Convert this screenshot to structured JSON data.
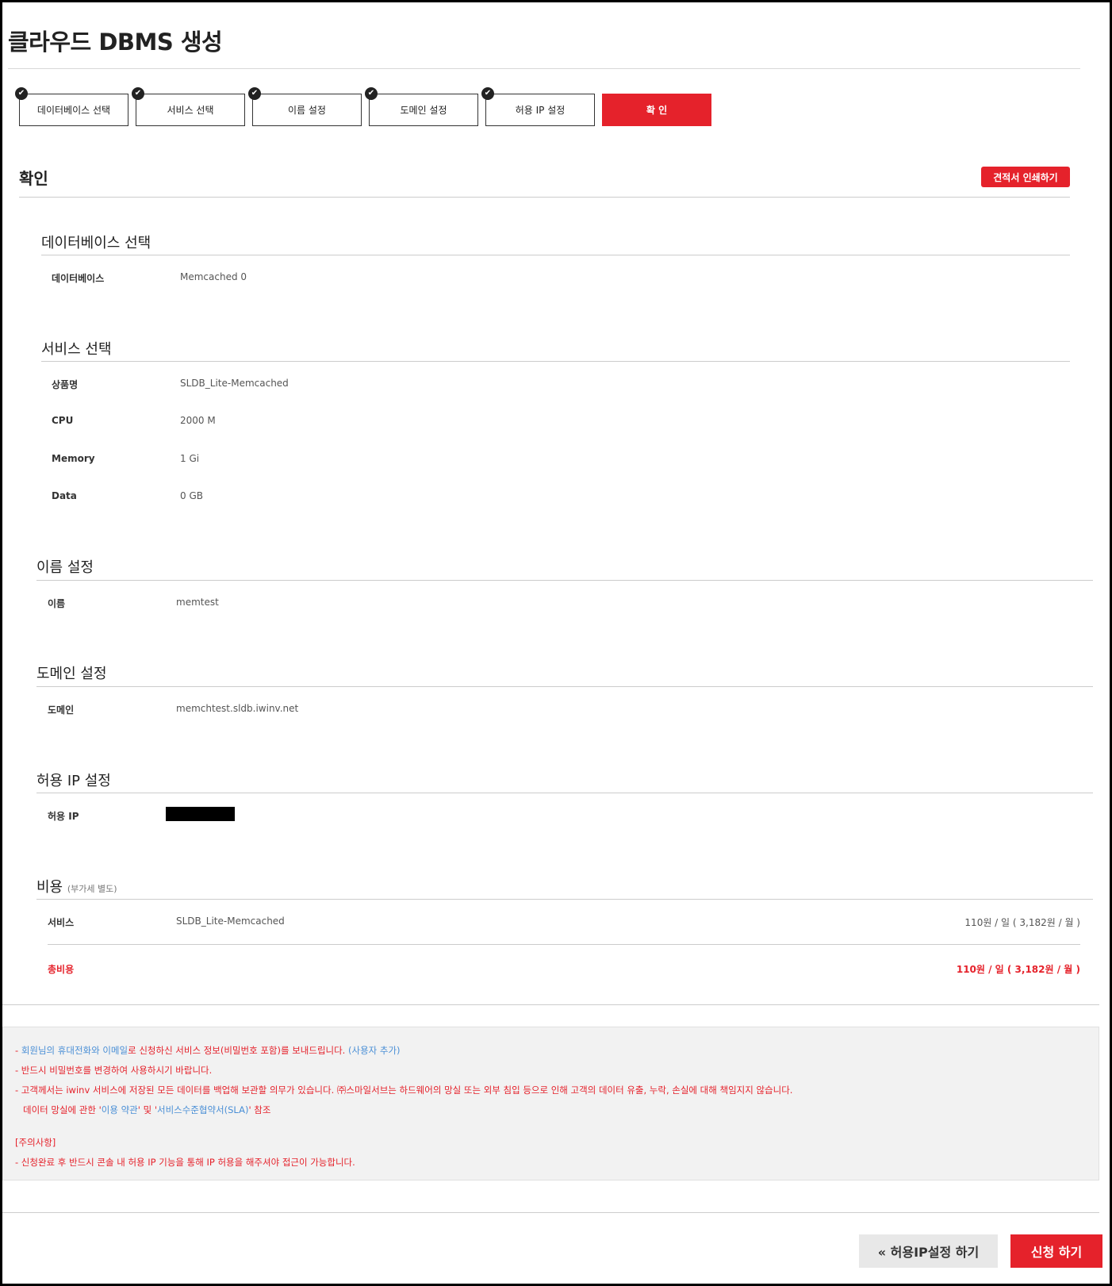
{
  "page": {
    "title": "클라우드 DBMS 생성"
  },
  "steps": [
    {
      "label": "데이터베이스 선택",
      "done": true
    },
    {
      "label": "서비스 선택",
      "done": true
    },
    {
      "label": "이름 설정",
      "done": true
    },
    {
      "label": "도메인 설정",
      "done": true
    },
    {
      "label": "허용 IP 설정",
      "done": true
    },
    {
      "label": "확 인",
      "done": false,
      "active": true
    }
  ],
  "confirm": {
    "title": "확인",
    "print_label": "견적서 인쇄하기"
  },
  "database": {
    "title": "데이터베이스 선택",
    "label": "데이터베이스",
    "value": "Memcached 0"
  },
  "service": {
    "title": "서비스 선택",
    "rows": [
      {
        "label": "상품명",
        "value": "SLDB_Lite-Memcached"
      },
      {
        "label": "CPU",
        "value": "2000 M"
      },
      {
        "label": "Memory",
        "value": "1 Gi"
      },
      {
        "label": "Data",
        "value": "0 GB"
      }
    ]
  },
  "name": {
    "title": "이름 설정",
    "label": "이름",
    "value": "memtest"
  },
  "domain": {
    "title": "도메인 설정",
    "label": "도메인",
    "value": "memchtest.sldb.iwinv.net"
  },
  "allowed_ip": {
    "title": "허용 IP 설정",
    "label": "허용 IP"
  },
  "cost": {
    "title": "비용",
    "note": "(부가세 별도)",
    "service_label": "서비스",
    "service_name": "SLDB_Lite-Memcached",
    "service_price": "110원 / 일 ( 3,182원 / 월 )",
    "total_label": "총비용",
    "total_price": "110원 / 일 ( 3,182원 / 월 )"
  },
  "notice": {
    "line1_a": "- ",
    "line1_b": "회원님의 휴대전화와 이메일",
    "line1_c": "로 신청하신 서비스 정보(비밀번호 포함)를 보내드립니다. ",
    "line1_d": "(사용자 추가)",
    "line2": "- 반드시 비밀번호를 변경하여 사용하시기 바랍니다.",
    "line3": "- 고객께서는 iwinv 서비스에 저장된 모든 데이터를 백업해 보관할 의무가 있습니다. ㈜스마일서브는 하드웨어의 망실 또는 외부 침입 등으로 인해 고객의 데이터 유출, 누락, 손실에 대해 책임지지 않습니다.",
    "line4_a": "데이터 망실에 관한 '",
    "line4_b": "이용 약관",
    "line4_c": "' 및 '",
    "line4_d": "서비스수준협약서(SLA)",
    "line4_e": "' 참조",
    "caution_title": "[주의사항]",
    "caution_line": "- 신청완료 후 반드시 콘솔 내 허용 IP 기능을 통해 IP 허용을 해주셔야 접근이 가능합니다."
  },
  "buttons": {
    "prev_label": "« 허용IP설정 하기",
    "submit_label": "신청 하기"
  },
  "colors": {
    "accent": "#e5222b",
    "link": "#4a8fd6"
  }
}
